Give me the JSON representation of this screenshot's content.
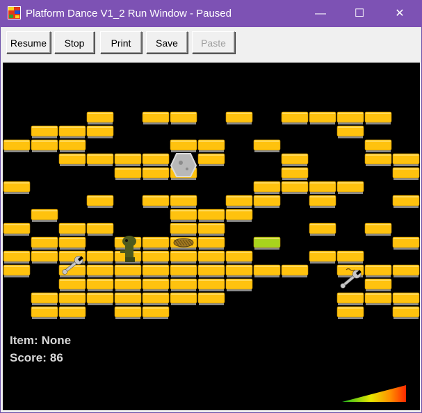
{
  "window": {
    "title": "Platform Dance V1_2 Run Window - Paused",
    "minimize_glyph": "—",
    "maximize_glyph": "☐",
    "close_glyph": "✕"
  },
  "toolbar": {
    "resume_label": "Resume",
    "stop_label": "Stop",
    "print_label": "Print",
    "save_label": "Save",
    "paste_label": "Paste"
  },
  "hud": {
    "item_label": "Item:",
    "item_value": "None",
    "score_label": "Score:",
    "score_value": "86"
  },
  "colors": {
    "tile_yellow": "#ffc20e",
    "tile_green": "#a8d41c",
    "tile_shadow": "#8a8a8a",
    "background": "#000000",
    "titlebar": "#7d52b4"
  },
  "game": {
    "grid_cols": 15,
    "grid_rows": 15,
    "yellow_tiles": [
      [
        3,
        0
      ],
      [
        5,
        0
      ],
      [
        6,
        0
      ],
      [
        8,
        0
      ],
      [
        10,
        0
      ],
      [
        11,
        0
      ],
      [
        12,
        0
      ],
      [
        13,
        0
      ],
      [
        1,
        1
      ],
      [
        2,
        1
      ],
      [
        3,
        1
      ],
      [
        12,
        1
      ],
      [
        0,
        2
      ],
      [
        1,
        2
      ],
      [
        2,
        2
      ],
      [
        6,
        2
      ],
      [
        7,
        2
      ],
      [
        9,
        2
      ],
      [
        13,
        2
      ],
      [
        2,
        3
      ],
      [
        3,
        3
      ],
      [
        4,
        3
      ],
      [
        5,
        3
      ],
      [
        7,
        3
      ],
      [
        10,
        3
      ],
      [
        13,
        3
      ],
      [
        14,
        3
      ],
      [
        4,
        4
      ],
      [
        5,
        4
      ],
      [
        6,
        4
      ],
      [
        10,
        4
      ],
      [
        14,
        4
      ],
      [
        0,
        5
      ],
      [
        9,
        5
      ],
      [
        10,
        5
      ],
      [
        11,
        5
      ],
      [
        12,
        5
      ],
      [
        3,
        6
      ],
      [
        5,
        6
      ],
      [
        6,
        6
      ],
      [
        8,
        6
      ],
      [
        9,
        6
      ],
      [
        11,
        6
      ],
      [
        14,
        6
      ],
      [
        1,
        7
      ],
      [
        6,
        7
      ],
      [
        7,
        7
      ],
      [
        8,
        7
      ],
      [
        0,
        8
      ],
      [
        2,
        8
      ],
      [
        3,
        8
      ],
      [
        6,
        8
      ],
      [
        7,
        8
      ],
      [
        11,
        8
      ],
      [
        13,
        8
      ],
      [
        1,
        9
      ],
      [
        2,
        9
      ],
      [
        4,
        9
      ],
      [
        5,
        9
      ],
      [
        6,
        9
      ],
      [
        7,
        9
      ],
      [
        14,
        9
      ],
      [
        0,
        10
      ],
      [
        1,
        10
      ],
      [
        2,
        10
      ],
      [
        3,
        10
      ],
      [
        4,
        10
      ],
      [
        5,
        10
      ],
      [
        6,
        10
      ],
      [
        7,
        10
      ],
      [
        8,
        10
      ],
      [
        11,
        10
      ],
      [
        12,
        10
      ],
      [
        0,
        11
      ],
      [
        2,
        11
      ],
      [
        3,
        11
      ],
      [
        4,
        11
      ],
      [
        5,
        11
      ],
      [
        6,
        11
      ],
      [
        7,
        11
      ],
      [
        8,
        11
      ],
      [
        9,
        11
      ],
      [
        10,
        11
      ],
      [
        12,
        11
      ],
      [
        13,
        11
      ],
      [
        14,
        11
      ],
      [
        2,
        12
      ],
      [
        3,
        12
      ],
      [
        4,
        12
      ],
      [
        5,
        12
      ],
      [
        6,
        12
      ],
      [
        7,
        12
      ],
      [
        8,
        12
      ],
      [
        13,
        12
      ],
      [
        1,
        13
      ],
      [
        2,
        13
      ],
      [
        3,
        13
      ],
      [
        4,
        13
      ],
      [
        5,
        13
      ],
      [
        6,
        13
      ],
      [
        7,
        13
      ],
      [
        12,
        13
      ],
      [
        13,
        13
      ],
      [
        14,
        13
      ],
      [
        1,
        14
      ],
      [
        2,
        14
      ],
      [
        4,
        14
      ],
      [
        5,
        14
      ],
      [
        12,
        14
      ],
      [
        14,
        14
      ]
    ],
    "green_tiles": [
      [
        9,
        9
      ]
    ],
    "boulder": [
      6,
      4
    ],
    "player": [
      4,
      10
    ],
    "wrenches": [
      [
        2,
        11
      ],
      [
        12,
        12
      ]
    ],
    "nest": [
      6,
      9
    ],
    "small_glyph": [
      12,
      11
    ]
  },
  "speed_meter": {
    "level": 1.0
  }
}
